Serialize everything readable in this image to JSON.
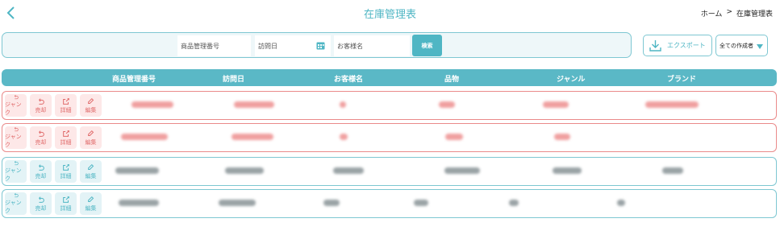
{
  "header": {
    "title": "在庫管理表"
  },
  "breadcrumb": {
    "home": "ホーム",
    "separator": ">",
    "current": "在庫管理表"
  },
  "search": {
    "product_code_placeholder": "商品管理番号",
    "visit_date_placeholder": "訪問日",
    "customer_placeholder": "お客様名",
    "button_label": "検索"
  },
  "toolbar": {
    "export_label": "エクスポート",
    "creator_filter": "全ての作成者"
  },
  "table": {
    "columns": [
      "商品管理番号",
      "訪問日",
      "お客様名",
      "品物",
      "ジャンル",
      "ブランド"
    ],
    "actions": [
      "ジャンク",
      "売却",
      "詳細",
      "編集"
    ],
    "rows": [
      {
        "status": "red"
      },
      {
        "status": "red"
      },
      {
        "status": "blue"
      },
      {
        "status": "blue"
      }
    ]
  },
  "colors": {
    "accent": "#4fb6c4",
    "header_bg": "#5ab8c6",
    "row_alert": "#ea8a8a",
    "row_normal": "#7ec7d2"
  },
  "icons": [
    "chevron-left-icon",
    "calendar-icon",
    "download-icon",
    "caret-down-icon",
    "undo-icon",
    "external-link-icon",
    "pencil-icon"
  ]
}
